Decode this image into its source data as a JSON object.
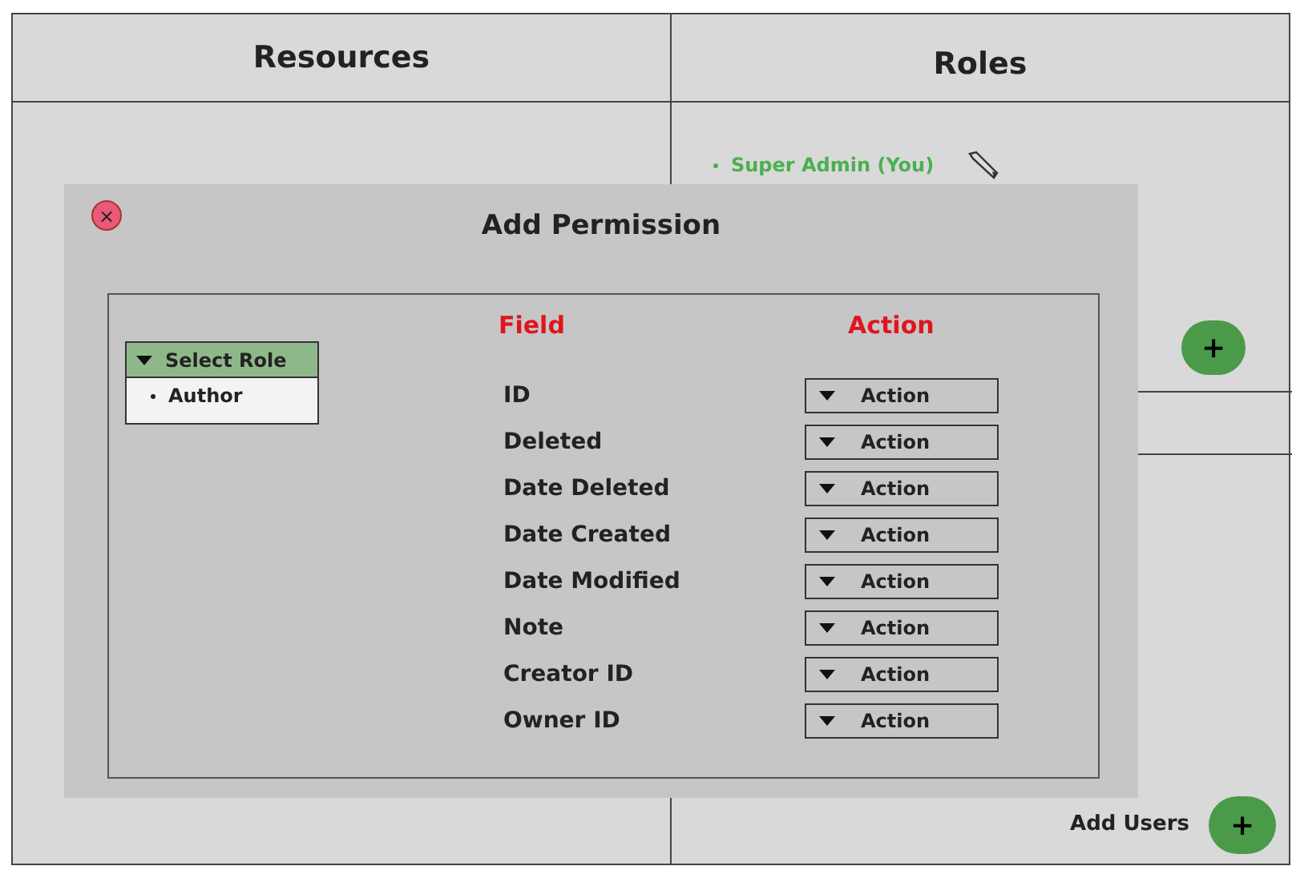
{
  "resources": {
    "title": "Resources"
  },
  "roles": {
    "title": "Roles",
    "items": [
      {
        "label": "Super Admin (You)"
      }
    ]
  },
  "add_users": {
    "label": "Add Users",
    "button": "+"
  },
  "add_role_button": "+",
  "modal": {
    "title": "Add Permission",
    "close": "×",
    "role_select": {
      "label": "Select Role",
      "options": [
        "Author"
      ]
    },
    "headers": {
      "field": "Field",
      "action": "Action"
    },
    "rows": [
      {
        "field": "ID",
        "action": "Action"
      },
      {
        "field": "Deleted",
        "action": "Action"
      },
      {
        "field": "Date Deleted",
        "action": "Action"
      },
      {
        "field": "Date Created",
        "action": "Action"
      },
      {
        "field": "Date Modified",
        "action": "Action"
      },
      {
        "field": "Note",
        "action": "Action"
      },
      {
        "field": "Creator ID",
        "action": "Action"
      },
      {
        "field": "Owner ID",
        "action": "Action"
      }
    ]
  }
}
